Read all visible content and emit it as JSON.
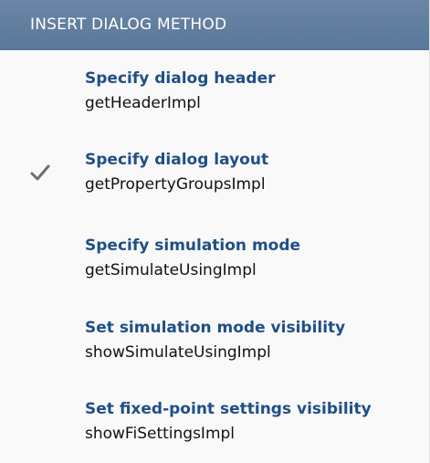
{
  "menu": {
    "header": "INSERT DIALOG METHOD",
    "items": [
      {
        "title": "Specify dialog header",
        "method": "getHeaderImpl",
        "checked": false
      },
      {
        "title": "Specify dialog layout",
        "method": "getPropertyGroupsImpl",
        "checked": true,
        "icon": "checkmark-icon"
      },
      {
        "title": "Specify simulation mode",
        "method": "getSimulateUsingImpl",
        "checked": false
      },
      {
        "title": "Set simulation mode visibility",
        "method": "showSimulateUsingImpl",
        "checked": false
      },
      {
        "title": "Set fixed-point settings visibility",
        "method": "showFiSettingsImpl",
        "checked": false
      }
    ]
  },
  "colors": {
    "header_bg": "#5f7c9f",
    "title_text": "#1f4f86",
    "method_text": "#111111",
    "check": "#6e6e6e"
  }
}
